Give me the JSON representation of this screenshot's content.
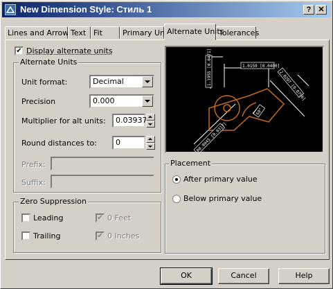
{
  "window": {
    "title": "New Dimension Style: Стиль 1",
    "help_button": "?",
    "close_button": "✕"
  },
  "tabs": [
    {
      "label": "Lines and Arrows"
    },
    {
      "label": "Text"
    },
    {
      "label": "Fit"
    },
    {
      "label": "Primary Units"
    },
    {
      "label": "Alternate Units"
    },
    {
      "label": "Tolerances"
    }
  ],
  "display_alternate": {
    "label": "Display alternate units",
    "checked": true
  },
  "alternate_units": {
    "title": "Alternate Units",
    "unit_format_label": "Unit format:",
    "unit_format_value": "Decimal",
    "precision_label": "Precision",
    "precision_value": "0.000",
    "multiplier_label": "Multiplier for alt units:",
    "multiplier_value": "0.039370",
    "round_label": "Round distances to:",
    "round_value": "0",
    "prefix_label": "Prefix:",
    "prefix_value": "",
    "suffix_label": "Suffix:",
    "suffix_value": ""
  },
  "zero_suppression": {
    "title": "Zero Suppression",
    "leading": "Leading",
    "trailing": "Trailing",
    "feet": "0 Feet",
    "inches": "0 Inches"
  },
  "preview": {
    "dim_top": "1.0159 [0.0400]",
    "dim_left": "1.1955 [0.0471]",
    "dim_right": "2.0207 [0.0796]",
    "dim_diag": "R0.8045 [0.0317]",
    "angle": "60°",
    "accent_color": "#c46a1e"
  },
  "placement": {
    "title": "Placement",
    "after": "After primary value",
    "below": "Below primary value",
    "selected": "after"
  },
  "buttons": {
    "ok": "OK",
    "cancel": "Cancel",
    "help": "Help"
  }
}
